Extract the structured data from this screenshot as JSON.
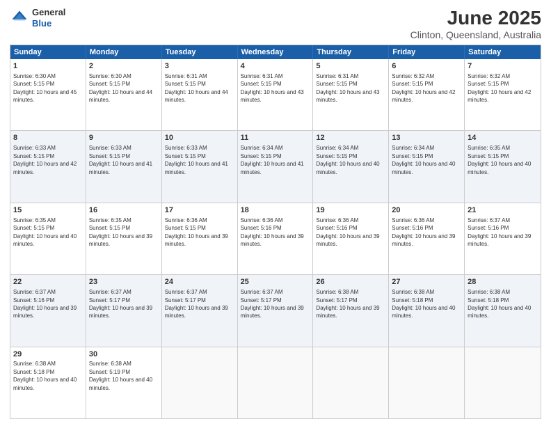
{
  "logo": {
    "general": "General",
    "blue": "Blue"
  },
  "title": "June 2025",
  "subtitle": "Clinton, Queensland, Australia",
  "header": {
    "days": [
      "Sunday",
      "Monday",
      "Tuesday",
      "Wednesday",
      "Thursday",
      "Friday",
      "Saturday"
    ]
  },
  "rows": [
    {
      "alt": false,
      "cells": [
        {
          "day": "1",
          "sunrise": "6:30 AM",
          "sunset": "5:15 PM",
          "daylight": "10 hours and 45 minutes."
        },
        {
          "day": "2",
          "sunrise": "6:30 AM",
          "sunset": "5:15 PM",
          "daylight": "10 hours and 44 minutes."
        },
        {
          "day": "3",
          "sunrise": "6:31 AM",
          "sunset": "5:15 PM",
          "daylight": "10 hours and 44 minutes."
        },
        {
          "day": "4",
          "sunrise": "6:31 AM",
          "sunset": "5:15 PM",
          "daylight": "10 hours and 43 minutes."
        },
        {
          "day": "5",
          "sunrise": "6:31 AM",
          "sunset": "5:15 PM",
          "daylight": "10 hours and 43 minutes."
        },
        {
          "day": "6",
          "sunrise": "6:32 AM",
          "sunset": "5:15 PM",
          "daylight": "10 hours and 42 minutes."
        },
        {
          "day": "7",
          "sunrise": "6:32 AM",
          "sunset": "5:15 PM",
          "daylight": "10 hours and 42 minutes."
        }
      ]
    },
    {
      "alt": true,
      "cells": [
        {
          "day": "8",
          "sunrise": "6:33 AM",
          "sunset": "5:15 PM",
          "daylight": "10 hours and 42 minutes."
        },
        {
          "day": "9",
          "sunrise": "6:33 AM",
          "sunset": "5:15 PM",
          "daylight": "10 hours and 41 minutes."
        },
        {
          "day": "10",
          "sunrise": "6:33 AM",
          "sunset": "5:15 PM",
          "daylight": "10 hours and 41 minutes."
        },
        {
          "day": "11",
          "sunrise": "6:34 AM",
          "sunset": "5:15 PM",
          "daylight": "10 hours and 41 minutes."
        },
        {
          "day": "12",
          "sunrise": "6:34 AM",
          "sunset": "5:15 PM",
          "daylight": "10 hours and 40 minutes."
        },
        {
          "day": "13",
          "sunrise": "6:34 AM",
          "sunset": "5:15 PM",
          "daylight": "10 hours and 40 minutes."
        },
        {
          "day": "14",
          "sunrise": "6:35 AM",
          "sunset": "5:15 PM",
          "daylight": "10 hours and 40 minutes."
        }
      ]
    },
    {
      "alt": false,
      "cells": [
        {
          "day": "15",
          "sunrise": "6:35 AM",
          "sunset": "5:15 PM",
          "daylight": "10 hours and 40 minutes."
        },
        {
          "day": "16",
          "sunrise": "6:35 AM",
          "sunset": "5:15 PM",
          "daylight": "10 hours and 39 minutes."
        },
        {
          "day": "17",
          "sunrise": "6:36 AM",
          "sunset": "5:15 PM",
          "daylight": "10 hours and 39 minutes."
        },
        {
          "day": "18",
          "sunrise": "6:36 AM",
          "sunset": "5:16 PM",
          "daylight": "10 hours and 39 minutes."
        },
        {
          "day": "19",
          "sunrise": "6:36 AM",
          "sunset": "5:16 PM",
          "daylight": "10 hours and 39 minutes."
        },
        {
          "day": "20",
          "sunrise": "6:36 AM",
          "sunset": "5:16 PM",
          "daylight": "10 hours and 39 minutes."
        },
        {
          "day": "21",
          "sunrise": "6:37 AM",
          "sunset": "5:16 PM",
          "daylight": "10 hours and 39 minutes."
        }
      ]
    },
    {
      "alt": true,
      "cells": [
        {
          "day": "22",
          "sunrise": "6:37 AM",
          "sunset": "5:16 PM",
          "daylight": "10 hours and 39 minutes."
        },
        {
          "day": "23",
          "sunrise": "6:37 AM",
          "sunset": "5:17 PM",
          "daylight": "10 hours and 39 minutes."
        },
        {
          "day": "24",
          "sunrise": "6:37 AM",
          "sunset": "5:17 PM",
          "daylight": "10 hours and 39 minutes."
        },
        {
          "day": "25",
          "sunrise": "6:37 AM",
          "sunset": "5:17 PM",
          "daylight": "10 hours and 39 minutes."
        },
        {
          "day": "26",
          "sunrise": "6:38 AM",
          "sunset": "5:17 PM",
          "daylight": "10 hours and 39 minutes."
        },
        {
          "day": "27",
          "sunrise": "6:38 AM",
          "sunset": "5:18 PM",
          "daylight": "10 hours and 40 minutes."
        },
        {
          "day": "28",
          "sunrise": "6:38 AM",
          "sunset": "5:18 PM",
          "daylight": "10 hours and 40 minutes."
        }
      ]
    },
    {
      "alt": false,
      "cells": [
        {
          "day": "29",
          "sunrise": "6:38 AM",
          "sunset": "5:18 PM",
          "daylight": "10 hours and 40 minutes."
        },
        {
          "day": "30",
          "sunrise": "6:38 AM",
          "sunset": "5:19 PM",
          "daylight": "10 hours and 40 minutes."
        },
        {
          "day": "",
          "sunrise": "",
          "sunset": "",
          "daylight": ""
        },
        {
          "day": "",
          "sunrise": "",
          "sunset": "",
          "daylight": ""
        },
        {
          "day": "",
          "sunrise": "",
          "sunset": "",
          "daylight": ""
        },
        {
          "day": "",
          "sunrise": "",
          "sunset": "",
          "daylight": ""
        },
        {
          "day": "",
          "sunrise": "",
          "sunset": "",
          "daylight": ""
        }
      ]
    }
  ],
  "labels": {
    "sunrise": "Sunrise:",
    "sunset": "Sunset:",
    "daylight": "Daylight:"
  }
}
